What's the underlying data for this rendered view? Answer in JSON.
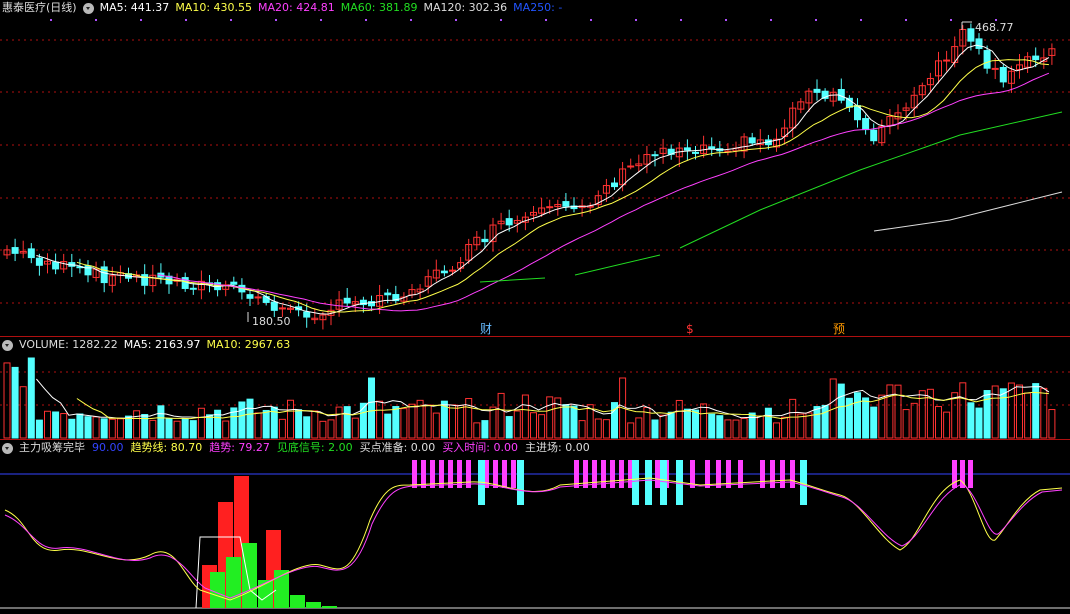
{
  "main": {
    "title": "惠泰医疗(日线)",
    "ma": [
      {
        "label": "MA5: 441.37",
        "color": "#ffffff"
      },
      {
        "label": "MA10: 430.55",
        "color": "#ffff4a"
      },
      {
        "label": "MA20: 424.81",
        "color": "#ff40ff"
      },
      {
        "label": "MA60: 381.89",
        "color": "#22dd22"
      },
      {
        "label": "MA120: 302.36",
        "color": "#dddddd"
      },
      {
        "label": "MA250: -",
        "color": "#2255ff"
      }
    ],
    "high_label": "468.77",
    "low_label": "180.50",
    "markers": [
      {
        "text": "财",
        "color": "#66bbff"
      },
      {
        "text": "$",
        "color": "#ff3333"
      },
      {
        "text": "预",
        "color": "#ff9900"
      }
    ]
  },
  "volume": {
    "labels": [
      {
        "label": "VOLUME: 1282.22",
        "color": "#dddddd"
      },
      {
        "label": "MA5: 2163.97",
        "color": "#ffffff"
      },
      {
        "label": "MA10: 2967.63",
        "color": "#ffff4a"
      }
    ]
  },
  "indicator": {
    "labels": [
      {
        "label": "主力吸筹完毕",
        "color": "#dddddd"
      },
      {
        "label": "90.00",
        "color": "#3344ff"
      },
      {
        "label": "趋势线: 80.70",
        "color": "#ffff4a"
      },
      {
        "label": "趋势: 79.27",
        "color": "#ff40ff"
      },
      {
        "label": "见底信号: 2.00",
        "color": "#22dd22"
      },
      {
        "label": "买点准备: 0.00",
        "color": "#dddddd"
      },
      {
        "label": "买入时间: 0.00",
        "color": "#ff40ff"
      },
      {
        "label": "主进场: 0.00",
        "color": "#dddddd"
      }
    ]
  },
  "colors": {
    "up": "#ff3232",
    "down": "#54ffff",
    "bg": "#000000",
    "grid": "#b01010"
  }
}
